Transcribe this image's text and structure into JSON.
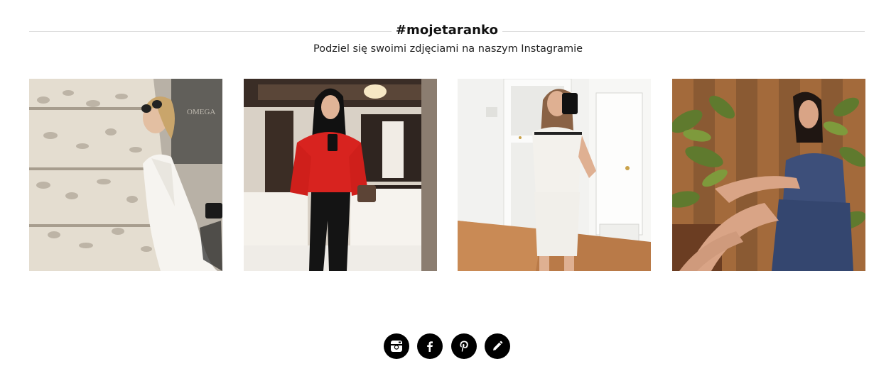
{
  "instagram_section": {
    "hashtag": "#mojetaranko",
    "subtitle": "Podziel się swoimi zdjęciami na naszym Instagramie",
    "photos": [
      {
        "description": "woman in white dress and sunglasses leaning on textured wall"
      },
      {
        "description": "woman in red blouse taking mirror selfie in living room"
      },
      {
        "description": "woman in white dress taking mirror selfie by door"
      },
      {
        "description": "woman in blue denim dress sitting among plants"
      }
    ]
  },
  "social": {
    "icons": [
      "instagram-icon",
      "facebook-icon",
      "pinterest-icon",
      "blog-pencil-icon"
    ],
    "color": "#000000"
  }
}
